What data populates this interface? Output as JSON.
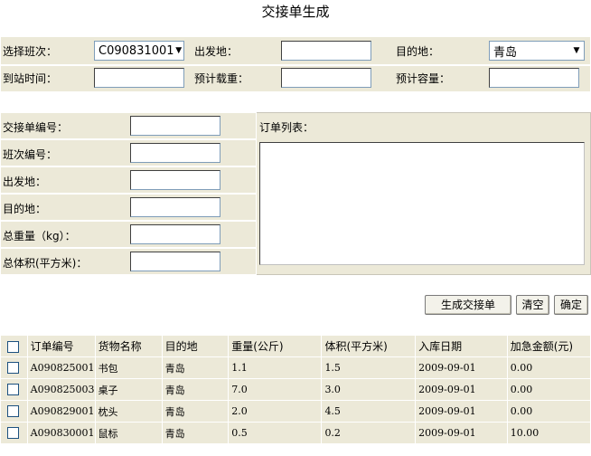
{
  "page": {
    "title": "交接单生成"
  },
  "top_form": {
    "select_shift_label": "选择班次：",
    "select_shift_value": "C090831001",
    "departure_label": "出发地：",
    "departure_value": "",
    "destination_label": "目的地：",
    "destination_value": "青岛",
    "arrival_time_label": "到站时间：",
    "arrival_time_value": "",
    "est_load_label": "预计载重：",
    "est_load_value": "",
    "est_capacity_label": "预计容量："
  },
  "handover_form": {
    "handover_no_label": "交接单编号：",
    "shift_no_label": "班次编号：",
    "departure_label": "出发地：",
    "destination_label": "目的地：",
    "total_weight_label": "总重量（kg）：",
    "total_volume_label": "总体积(平方米)：",
    "order_list_label": "订单列表："
  },
  "buttons": {
    "generate": "生成交接单",
    "clear": "清空",
    "confirm": "确定"
  },
  "table": {
    "columns": [
      "订单编号",
      "货物名称",
      "目的地",
      "重量(公斤)",
      "体积(平方米)",
      "入库日期",
      "加急金额(元)"
    ],
    "rows": [
      [
        "A090825001",
        "书包",
        "青岛",
        "1.1",
        "1.5",
        "2009-09-01",
        "0.00"
      ],
      [
        "A090825003",
        "桌子",
        "青岛",
        "7.0",
        "3.0",
        "2009-09-01",
        "0.00"
      ],
      [
        "A090829001",
        "枕头",
        "青岛",
        "2.0",
        "4.5",
        "2009-09-01",
        "0.00"
      ],
      [
        "A090830001",
        "鼠标",
        "青岛",
        "0.5",
        "0.2",
        "2009-09-01",
        "10.00"
      ]
    ]
  }
}
